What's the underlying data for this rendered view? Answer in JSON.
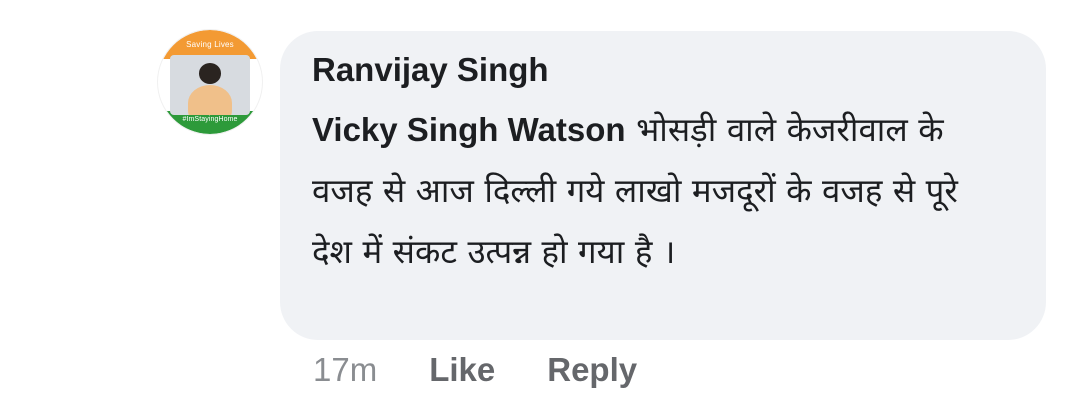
{
  "comment": {
    "author": "Ranvijay Singh",
    "mention": "Vicky Singh Watson",
    "text_after_mention": " भोसड़ी वाले केजरीवाल के वजह से आज दिल्ली गये लाखो मजदूरों के वजह से पूरे देश में संकट उत्पन्न हो गया है ।",
    "timestamp": "17m",
    "actions": {
      "like": "Like",
      "reply": "Reply"
    },
    "avatar": {
      "top_text": "Saving Lives",
      "bottom_text": "#ImStayingHome",
      "icon": "user-avatar-icon"
    }
  },
  "colors": {
    "bubble_bg": "#f0f2f5",
    "text_primary": "#1c1e21",
    "text_secondary": "#65676b",
    "avatar_saffron": "#f39a33",
    "avatar_green": "#2d9a3a"
  }
}
